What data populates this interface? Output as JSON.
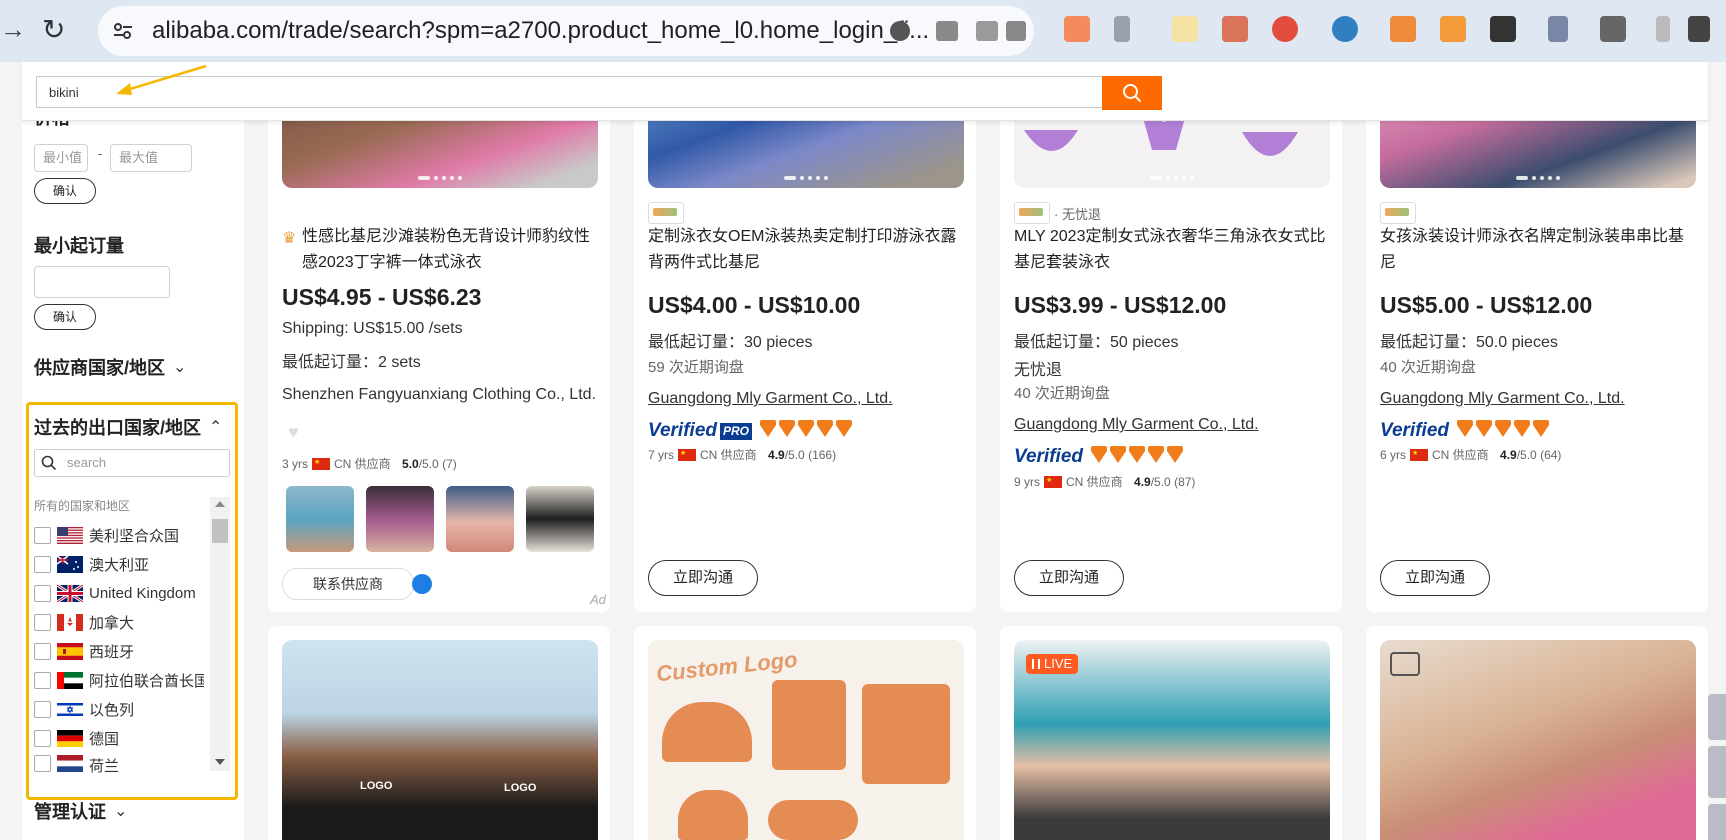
{
  "browser": {
    "url": "alibaba.com/trade/search?spm=a2700.product_home_l0.home_login_fi..."
  },
  "search": {
    "value": "bikini"
  },
  "sidebar": {
    "price_heading": "价格",
    "min_price_placeholder": "最小值",
    "dash": "-",
    "max_price_placeholder": "最大值",
    "confirm_label": "确认",
    "moq_heading": "最小起订量",
    "supplier_country_heading": "供应商国家/地区",
    "export_country_heading": "过去的出口国家/地区",
    "country_search_placeholder": "search",
    "all_countries_label": "所有的国家和地区",
    "countries": [
      {
        "name": "美利坚合众国",
        "flag": "us-flag"
      },
      {
        "name": "澳大利亚",
        "flag": "au-flag"
      },
      {
        "name": "United Kingdom",
        "flag": "gb-flag"
      },
      {
        "name": "加拿大",
        "flag": "ca-flag"
      },
      {
        "name": "西班牙",
        "flag": "es-flag"
      },
      {
        "name": "阿拉伯联合酋长国",
        "flag": "ae-flag"
      },
      {
        "name": "以色列",
        "flag": "il-flag"
      },
      {
        "name": "德国",
        "flag": "de-flag"
      },
      {
        "name": "荷兰",
        "flag": "nl-flag"
      }
    ],
    "management_cert_heading": "管理认证"
  },
  "products": [
    {
      "title": "性感比基尼沙滩装粉色无背设计师豹纹性感2023丁字裤一体式泳衣",
      "price": "US$4.95 - US$6.23",
      "shipping": "Shipping: US$15.00 /sets",
      "moq": "最低起订量：2 sets",
      "supplier": "Shenzhen Fangyuanxiang Clothing Co., Ltd.",
      "years": "3 yrs",
      "country": "CN 供应商",
      "rating": "5.0",
      "rating_suffix": "/5.0 (7)",
      "contact_label": "联系供应商",
      "ad_label": "Ad"
    },
    {
      "title": "定制泳衣女OEM泳装热卖定制打印游泳衣露背两件式比基尼",
      "price": "US$4.00 - US$10.00",
      "moq": "最低起订量：30 pieces",
      "inquiries": "59 次近期询盘",
      "supplier": "Guangdong Mly Garment Co., Ltd.",
      "verified": "Verified",
      "pro": "PRO",
      "years": "7 yrs",
      "country": "CN 供应商",
      "rating": "4.9",
      "rating_suffix": "/5.0 (166)",
      "chat_label": "立即沟通"
    },
    {
      "tag": "· 无忧退",
      "title": "MLY 2023定制女式泳衣奢华三角泳衣女式比基尼套装泳衣",
      "price": "US$3.99 - US$12.00",
      "moq": "最低起订量：50 pieces",
      "worry_free": "无忧退",
      "inquiries": "40 次近期询盘",
      "supplier": "Guangdong Mly Garment Co., Ltd.",
      "verified": "Verified",
      "years": "9 yrs",
      "country": "CN 供应商",
      "rating": "4.9",
      "rating_suffix": "/5.0 (87)",
      "chat_label": "立即沟通"
    },
    {
      "title": "女孩泳装设计师泳衣名牌定制泳装串串比基尼",
      "price": "US$5.00 - US$12.00",
      "moq": "最低起订量：50.0 pieces",
      "inquiries": "40 次近期询盘",
      "supplier": "Guangdong Mly Garment Co., Ltd.",
      "verified": "Verified",
      "years": "6 yrs",
      "country": "CN 供应商",
      "rating": "4.9",
      "rating_suffix": "/5.0 (64)",
      "chat_label": "立即沟通"
    }
  ],
  "row2": {
    "custom_logo_text": "Custom Logo",
    "live_badge": "LIVE",
    "logo_text": "LOGO"
  },
  "colors": {
    "accent": "#ff6a00",
    "highlight": "#f5b800",
    "verified": "#0a3d91"
  }
}
